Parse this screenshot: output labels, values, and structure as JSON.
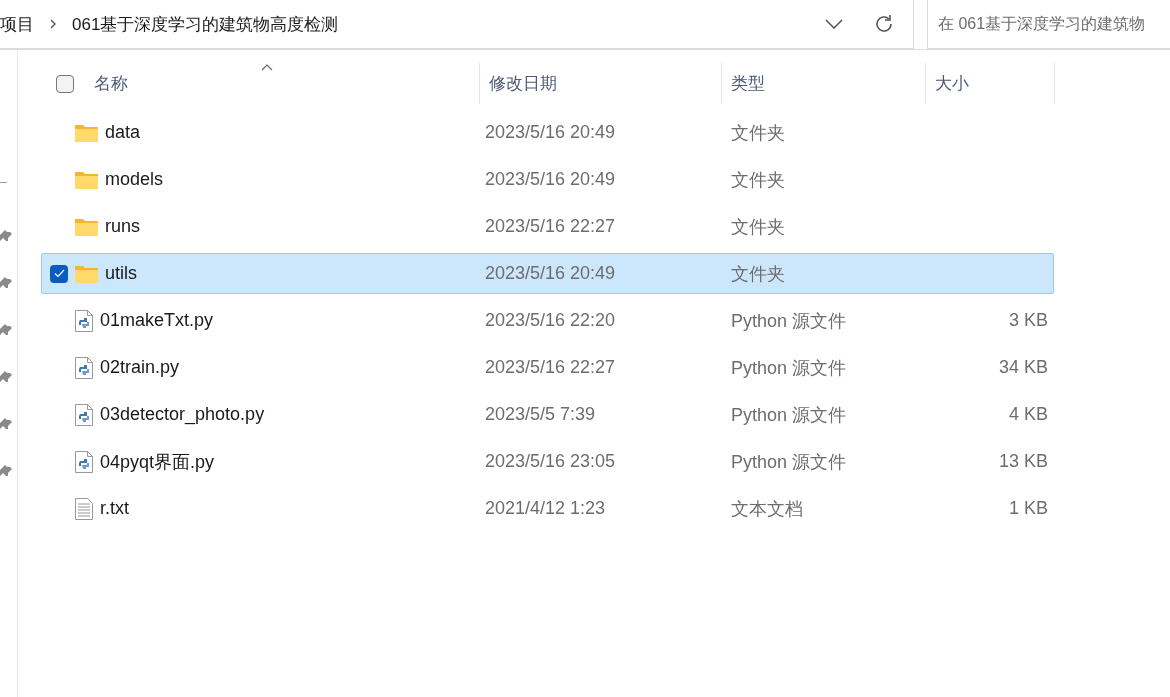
{
  "address_bar": {
    "breadcrumbs": [
      "项目",
      "061基于深度学习的建筑物高度检测"
    ]
  },
  "search": {
    "placeholder": "在 061基于深度学习的建筑物"
  },
  "table": {
    "select_all": {
      "checked": false
    },
    "columns": [
      "名称",
      "修改日期",
      "类型",
      "大小"
    ],
    "rows": [
      {
        "kind": "folder",
        "name": "data",
        "modified": "2023/5/16 20:49",
        "type": "文件夹",
        "selected": false
      },
      {
        "kind": "folder",
        "name": "models",
        "modified": "2023/5/16 20:49",
        "type": "文件夹",
        "selected": false
      },
      {
        "kind": "folder",
        "name": "runs",
        "modified": "2023/5/16 22:27",
        "type": "文件夹",
        "selected": false
      },
      {
        "kind": "folder",
        "name": "utils",
        "modified": "2023/5/16 20:49",
        "type": "文件夹",
        "selected": true
      },
      {
        "kind": "python",
        "name": "01makeTxt.py",
        "modified": "2023/5/16 22:20",
        "type": "Python 源文件",
        "size": "3 KB",
        "selected": false
      },
      {
        "kind": "python",
        "name": "02train.py",
        "modified": "2023/5/16 22:27",
        "type": "Python 源文件",
        "size": "34 KB",
        "selected": false
      },
      {
        "kind": "python",
        "name": "03detector_photo.py",
        "modified": "2023/5/5 7:39",
        "type": "Python 源文件",
        "size": "4 KB",
        "selected": false
      },
      {
        "kind": "python",
        "name": "04pyqt界面.py",
        "modified": "2023/5/16 23:05",
        "type": "Python 源文件",
        "size": "13 KB",
        "selected": false
      },
      {
        "kind": "text",
        "name": "r.txt",
        "modified": "2021/4/12 1:23",
        "type": "文本文档",
        "size": "1 KB",
        "selected": false
      }
    ]
  }
}
